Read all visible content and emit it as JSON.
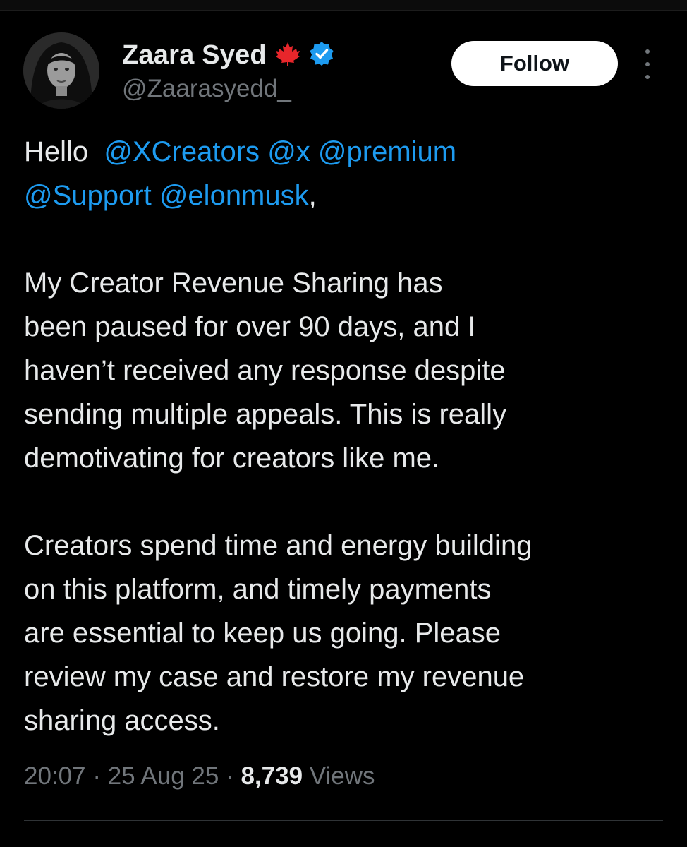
{
  "author": {
    "display_name": "Zaara Syed",
    "handle": "@Zaarasyedd_",
    "flag_icon": "maple-leaf-icon",
    "verified_icon": "verified-badge-icon",
    "verified_color": "#1d9bf0"
  },
  "follow_button": {
    "label": "Follow"
  },
  "tweet": {
    "greeting": "Hello",
    "mentions": [
      "@XCreators",
      "@x",
      "@premium",
      "@Support",
      "@elonmusk"
    ],
    "greeting_suffix": ",",
    "paragraph_2_lines": [
      "My Creator Revenue Sharing has",
      "been paused for over 90 days, and I",
      "haven’t received any response despite",
      "sending multiple appeals. This is really",
      "demotivating for creators like me."
    ],
    "paragraph_3_lines": [
      "Creators spend time and energy building",
      "on this platform, and timely payments",
      "are essential to keep us going. Please",
      "review my case and restore my revenue",
      "sharing access."
    ]
  },
  "meta": {
    "time": "20:07",
    "separator": " · ",
    "date": "25 Aug 25",
    "views_count": "8,739",
    "views_label": " Views"
  },
  "colors": {
    "background": "#000000",
    "text": "#e7e9ea",
    "muted": "#71767b",
    "link": "#1d9bf0"
  }
}
